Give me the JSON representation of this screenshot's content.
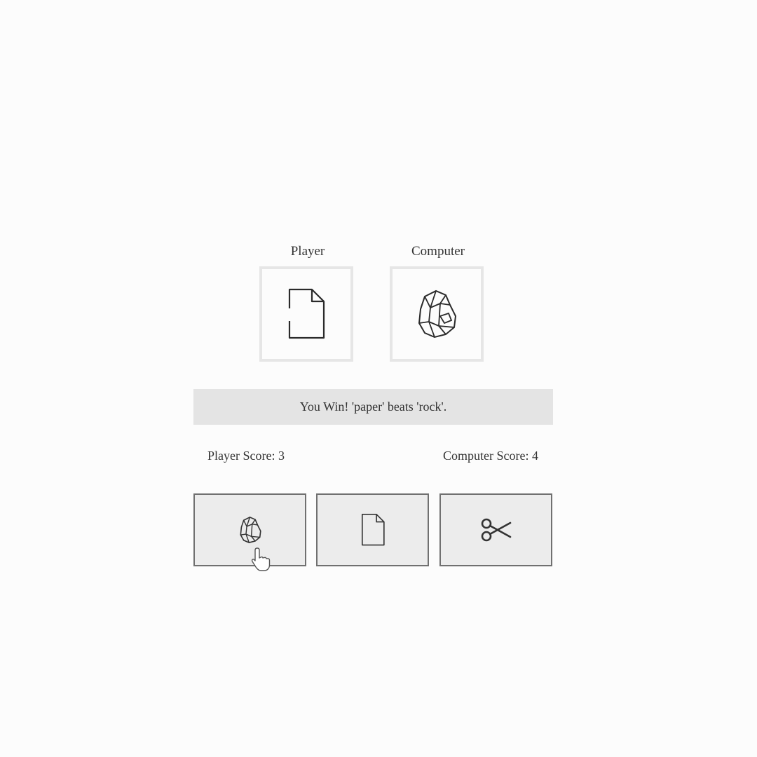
{
  "hands": {
    "player": {
      "label": "Player",
      "choice_icon": "paper-icon"
    },
    "computer": {
      "label": "Computer",
      "choice_icon": "rock-icon"
    }
  },
  "result": {
    "message": "You Win! 'paper' beats 'rock'."
  },
  "scores": {
    "player": "Player Score: 3",
    "computer": "Computer Score: 4"
  },
  "choices": [
    {
      "name": "rock",
      "icon": "rock-icon"
    },
    {
      "name": "paper",
      "icon": "paper-icon"
    },
    {
      "name": "scissors",
      "icon": "scissors-icon"
    }
  ],
  "colors": {
    "background": "#fcfcfc",
    "result_bar": "#e4e4e4",
    "button_bg": "#ececec",
    "button_border": "#707070",
    "hand_box_border": "#e6e6e6"
  }
}
